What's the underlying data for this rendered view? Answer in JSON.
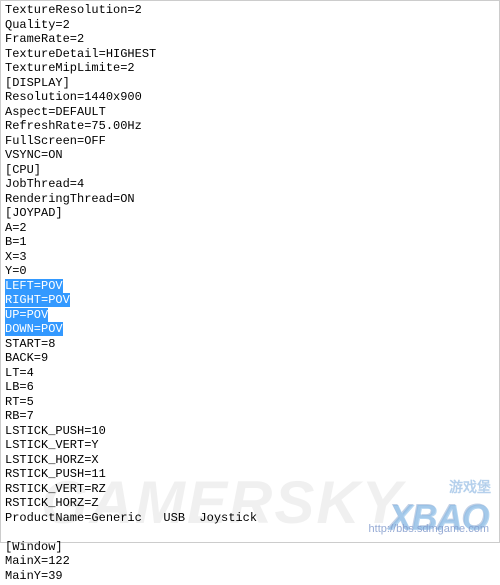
{
  "lines": [
    {
      "text": "TextureResolution=2",
      "selected": false
    },
    {
      "text": "Quality=2",
      "selected": false
    },
    {
      "text": "FrameRate=2",
      "selected": false
    },
    {
      "text": "TextureDetail=HIGHEST",
      "selected": false
    },
    {
      "text": "TextureMipLimite=2",
      "selected": false
    },
    {
      "text": "[DISPLAY]",
      "selected": false
    },
    {
      "text": "Resolution=1440x900",
      "selected": false
    },
    {
      "text": "Aspect=DEFAULT",
      "selected": false
    },
    {
      "text": "RefreshRate=75.00Hz",
      "selected": false
    },
    {
      "text": "FullScreen=OFF",
      "selected": false
    },
    {
      "text": "VSYNC=ON",
      "selected": false
    },
    {
      "text": "[CPU]",
      "selected": false
    },
    {
      "text": "JobThread=4",
      "selected": false
    },
    {
      "text": "RenderingThread=ON",
      "selected": false
    },
    {
      "text": "[JOYPAD]",
      "selected": false
    },
    {
      "text": "A=2",
      "selected": false
    },
    {
      "text": "B=1",
      "selected": false
    },
    {
      "text": "X=3",
      "selected": false
    },
    {
      "text": "Y=0",
      "selected": false
    },
    {
      "text": "LEFT=POV",
      "selected": true
    },
    {
      "text": "RIGHT=POV",
      "selected": true
    },
    {
      "text": "UP=POV",
      "selected": true
    },
    {
      "text": "DOWN=POV",
      "selected": true
    },
    {
      "text": "START=8",
      "selected": false
    },
    {
      "text": "BACK=9",
      "selected": false
    },
    {
      "text": "LT=4",
      "selected": false
    },
    {
      "text": "LB=6",
      "selected": false
    },
    {
      "text": "RT=5",
      "selected": false
    },
    {
      "text": "RB=7",
      "selected": false
    },
    {
      "text": "LSTICK_PUSH=10",
      "selected": false
    },
    {
      "text": "LSTICK_VERT=Y",
      "selected": false
    },
    {
      "text": "LSTICK_HORZ=X",
      "selected": false
    },
    {
      "text": "RSTICK_PUSH=11",
      "selected": false
    },
    {
      "text": "RSTICK_VERT=RZ",
      "selected": false
    },
    {
      "text": "RSTICK_HORZ=Z",
      "selected": false
    },
    {
      "text": "ProductName=Generic   USB  Joystick",
      "selected": false
    },
    {
      "text": "",
      "selected": false
    },
    {
      "text": "[Window]",
      "selected": false
    },
    {
      "text": "MainX=122",
      "selected": false
    },
    {
      "text": "MainY=39",
      "selected": false
    }
  ],
  "watermark": {
    "gamersky": "GAMERSKY",
    "xbao": "XBAO",
    "cn": "游戏堡",
    "url": "http://bbs.sdmgame.com"
  }
}
